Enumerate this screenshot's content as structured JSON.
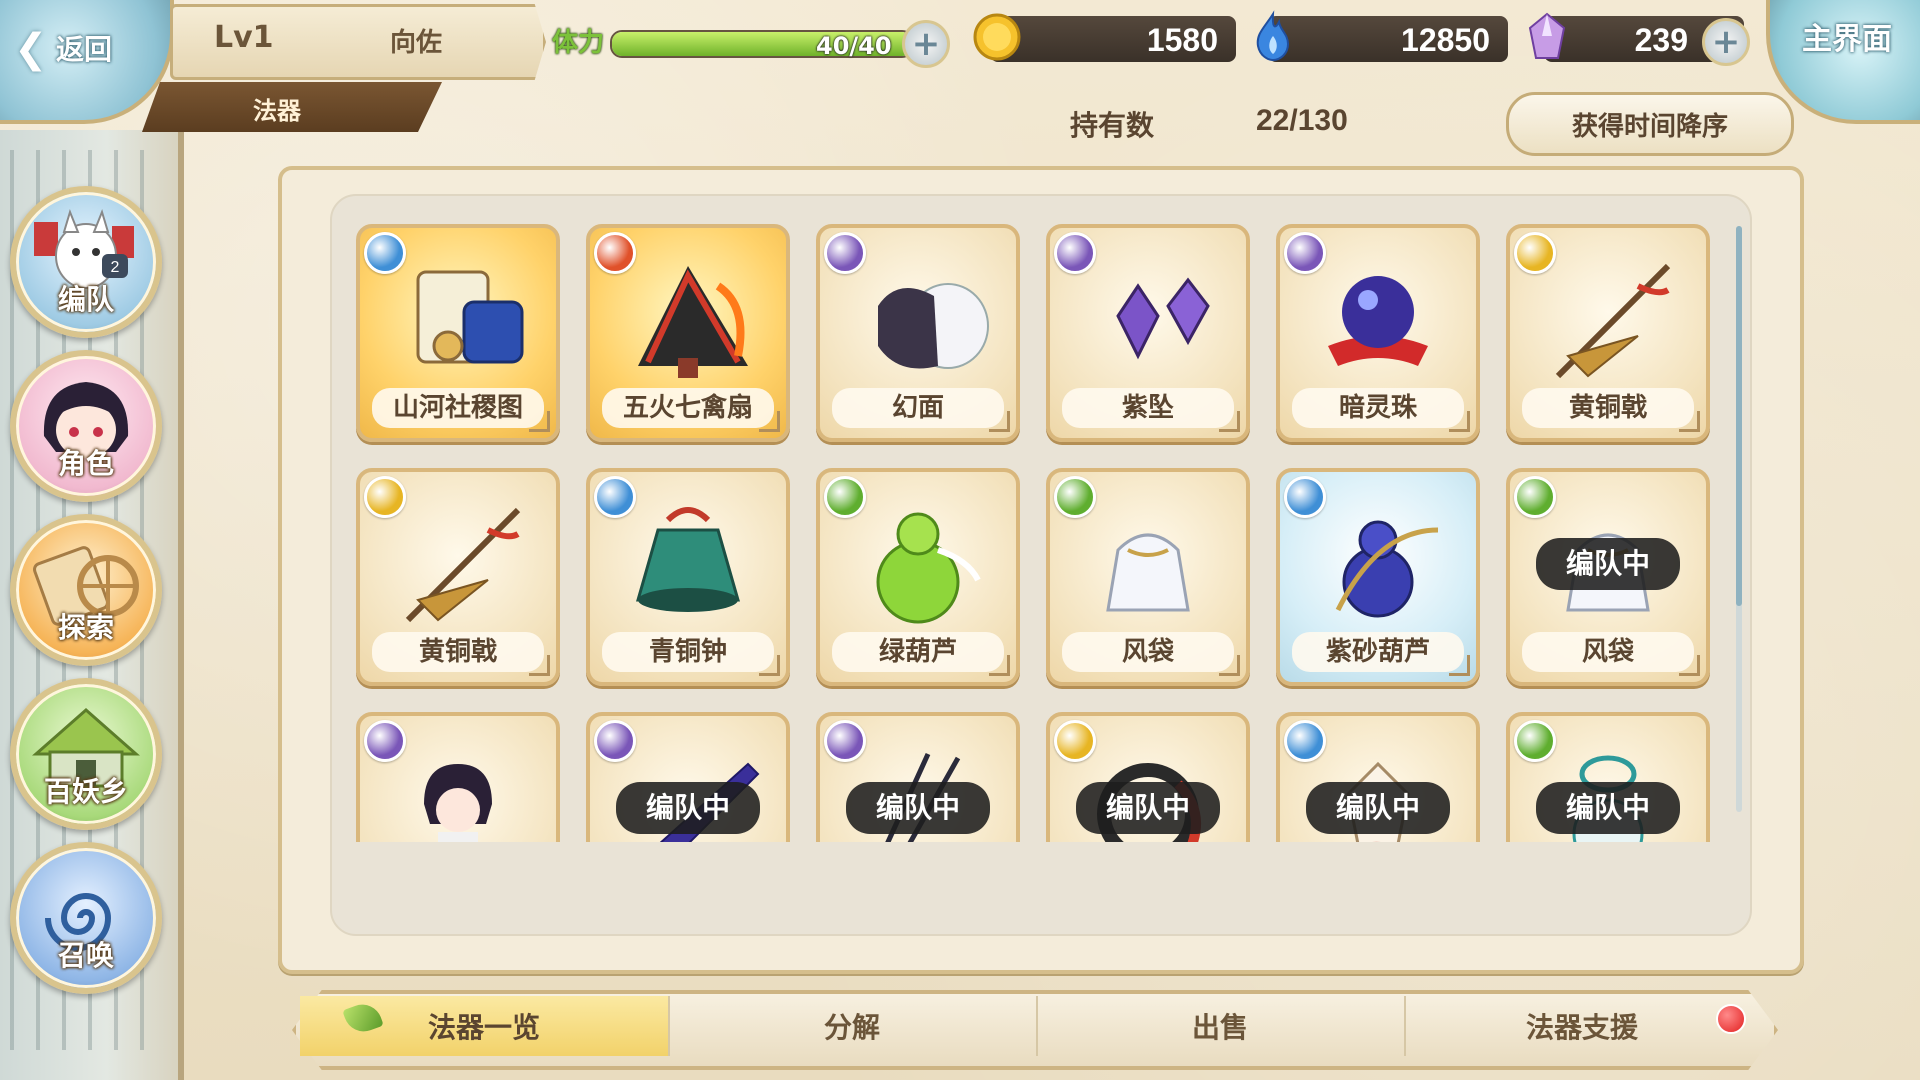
{
  "header": {
    "back_label": "返回",
    "level": "Lv1",
    "player_name": "向佐",
    "section": "法器",
    "stamina_label": "体力",
    "stamina_text": "40/40",
    "stamina_fraction": 1.0,
    "gold": "1580",
    "soul_fire": "12850",
    "crystal": "239",
    "main_label": "主界面"
  },
  "toolbar": {
    "holding_label": "持有数",
    "holding_count": "22/130",
    "sort_label": "获得时间降序"
  },
  "side_nav": [
    {
      "label": "编队",
      "icon": "team-icon"
    },
    {
      "label": "角色",
      "icon": "character-icon"
    },
    {
      "label": "探索",
      "icon": "explore-icon"
    },
    {
      "label": "百妖乡",
      "icon": "village-icon"
    },
    {
      "label": "召唤",
      "icon": "summon-icon"
    }
  ],
  "items": [
    {
      "name": "山河社稷图",
      "element": "water",
      "frame": "gold",
      "icon": "scroll-icon",
      "badge": ""
    },
    {
      "name": "五火七禽扇",
      "element": "fire",
      "frame": "gold",
      "icon": "fan-icon",
      "badge": ""
    },
    {
      "name": "幻面",
      "element": "dark",
      "frame": "pale",
      "icon": "mask-icon",
      "badge": ""
    },
    {
      "name": "紫坠",
      "element": "dark",
      "frame": "pale",
      "icon": "pendant-icon",
      "badge": ""
    },
    {
      "name": "暗灵珠",
      "element": "dark",
      "frame": "pale",
      "icon": "orb-icon",
      "badge": ""
    },
    {
      "name": "黄铜戟",
      "element": "light",
      "frame": "pale",
      "icon": "halberd-icon",
      "badge": ""
    },
    {
      "name": "黄铜戟",
      "element": "light",
      "frame": "pale",
      "icon": "halberd-icon",
      "badge": ""
    },
    {
      "name": "青铜钟",
      "element": "water",
      "frame": "pale",
      "icon": "bell-icon",
      "badge": ""
    },
    {
      "name": "绿葫芦",
      "element": "wind",
      "frame": "pale",
      "icon": "gourd-icon",
      "badge": ""
    },
    {
      "name": "风袋",
      "element": "wind",
      "frame": "pale",
      "icon": "wind-bag-icon",
      "badge": ""
    },
    {
      "name": "紫砂葫芦",
      "element": "water",
      "frame": "blue",
      "icon": "purple-gourd-icon",
      "badge": ""
    },
    {
      "name": "风袋",
      "element": "wind",
      "frame": "pale",
      "icon": "wind-bag-icon",
      "badge": "编队中"
    },
    {
      "name": "",
      "element": "dark",
      "frame": "pale",
      "icon": "doll-icon",
      "badge": ""
    },
    {
      "name": "",
      "element": "dark",
      "frame": "pale",
      "icon": "blade-icon",
      "badge": "编队中"
    },
    {
      "name": "",
      "element": "dark",
      "frame": "pale",
      "icon": "claw-icon",
      "badge": "编队中"
    },
    {
      "name": "",
      "element": "light",
      "frame": "pale",
      "icon": "ring-icon",
      "badge": "编队中"
    },
    {
      "name": "",
      "element": "water",
      "frame": "pale",
      "icon": "fox-mask-icon",
      "badge": "编队中"
    },
    {
      "name": "",
      "element": "wind",
      "frame": "pale",
      "icon": "charm-icon",
      "badge": "编队中"
    }
  ],
  "tabs": [
    {
      "label": "法器一览",
      "active": true
    },
    {
      "label": "分解",
      "active": false
    },
    {
      "label": "出售",
      "active": false
    },
    {
      "label": "法器支援",
      "active": false,
      "notify": true
    }
  ],
  "colors": {
    "water": "#3f8fd6",
    "fire": "#e0512a",
    "dark": "#7a56b8",
    "light": "#e7b523",
    "wind": "#5fae2f"
  }
}
